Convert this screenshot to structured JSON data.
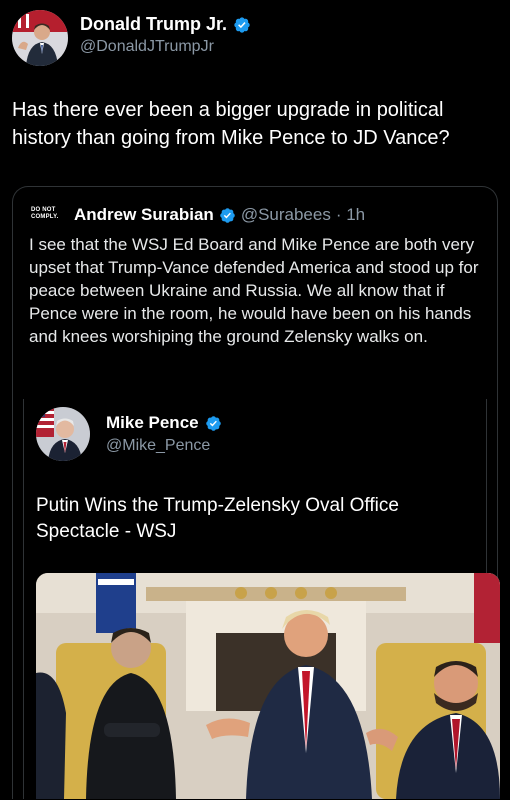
{
  "tweet": {
    "author": {
      "name": "Donald Trump Jr.",
      "handle": "@DonaldJTrumpJr",
      "verified": true,
      "avatar_icon": "profile-photo-icon"
    },
    "text": "Has there ever been a bigger upgrade in political history than going from Mike Pence to JD Vance?"
  },
  "quoted": {
    "logo_text_line1": "DO NOT",
    "logo_text_line2": "COMPLY.",
    "author": {
      "name": "Andrew Surabian",
      "handle": "@Surabees",
      "time": "· 1h",
      "verified": true
    },
    "text": "I see that the WSJ Ed Board and Mike Pence are both very upset that Trump-Vance defended America and stood up for peace between Ukraine and Russia. We all know that if Pence were in the room, he would have been on his hands and knees worshiping the ground Zelensky walks on.",
    "inner": {
      "author": {
        "name": "Mike Pence",
        "handle": "@Mike_Pence",
        "verified": true,
        "avatar_icon": "profile-photo-icon"
      },
      "text": "Putin Wins the Trump-Zelensky Oval Office Spectacle - WSJ",
      "image_icon": "oval-office-photo"
    }
  },
  "colors": {
    "background": "#000000",
    "verified_badge": "#1d9bf0",
    "secondary_text": "#8b98a5",
    "border": "#2f3336"
  }
}
